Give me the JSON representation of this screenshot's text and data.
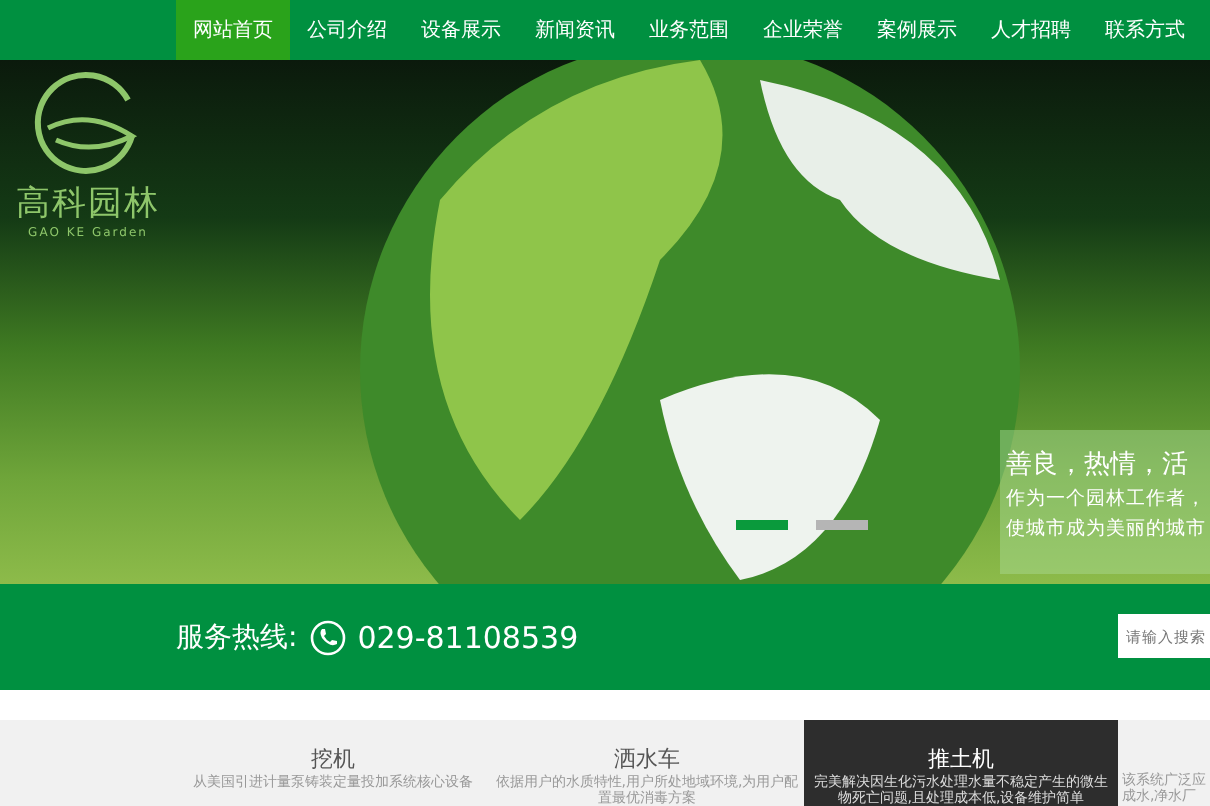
{
  "nav": {
    "items": [
      {
        "label": "网站首页",
        "selected": true
      },
      {
        "label": "公司介绍",
        "selected": false
      },
      {
        "label": "设备展示",
        "selected": false
      },
      {
        "label": "新闻资讯",
        "selected": false
      },
      {
        "label": "业务范围",
        "selected": false
      },
      {
        "label": "企业荣誉",
        "selected": false
      },
      {
        "label": "案例展示",
        "selected": false
      },
      {
        "label": "人才招聘",
        "selected": false
      },
      {
        "label": "联系方式",
        "selected": false
      }
    ]
  },
  "logo": {
    "name": "高科园林",
    "subtitle": "GAO KE Garden"
  },
  "hero": {
    "caption": {
      "title": "善良，热情，活",
      "lines": [
        "作为一个园林工作者，",
        "使城市成为美丽的城市"
      ]
    },
    "dots": [
      {
        "selected": true
      },
      {
        "selected": false
      }
    ]
  },
  "service": {
    "label": "服务热线:",
    "phone": "029-81108539",
    "search_placeholder": "请输入搜索"
  },
  "cards": [
    {
      "title": "挖机",
      "text": "从美国引进计量泵铸装定量投加系统核心设备",
      "selected": false
    },
    {
      "title": "洒水车",
      "text": "依据用户的水质特性,用户所处地域环境,为用户配置最优消毒方案",
      "selected": false
    },
    {
      "title": "推土机",
      "text": "完美解决因生化污水处理水量不稳定产生的微生物死亡问题,且处理成本低,设备维护简单",
      "selected": true
    },
    {
      "text": "该系统广泛应成水,净水厂",
      "selected": false
    }
  ]
}
